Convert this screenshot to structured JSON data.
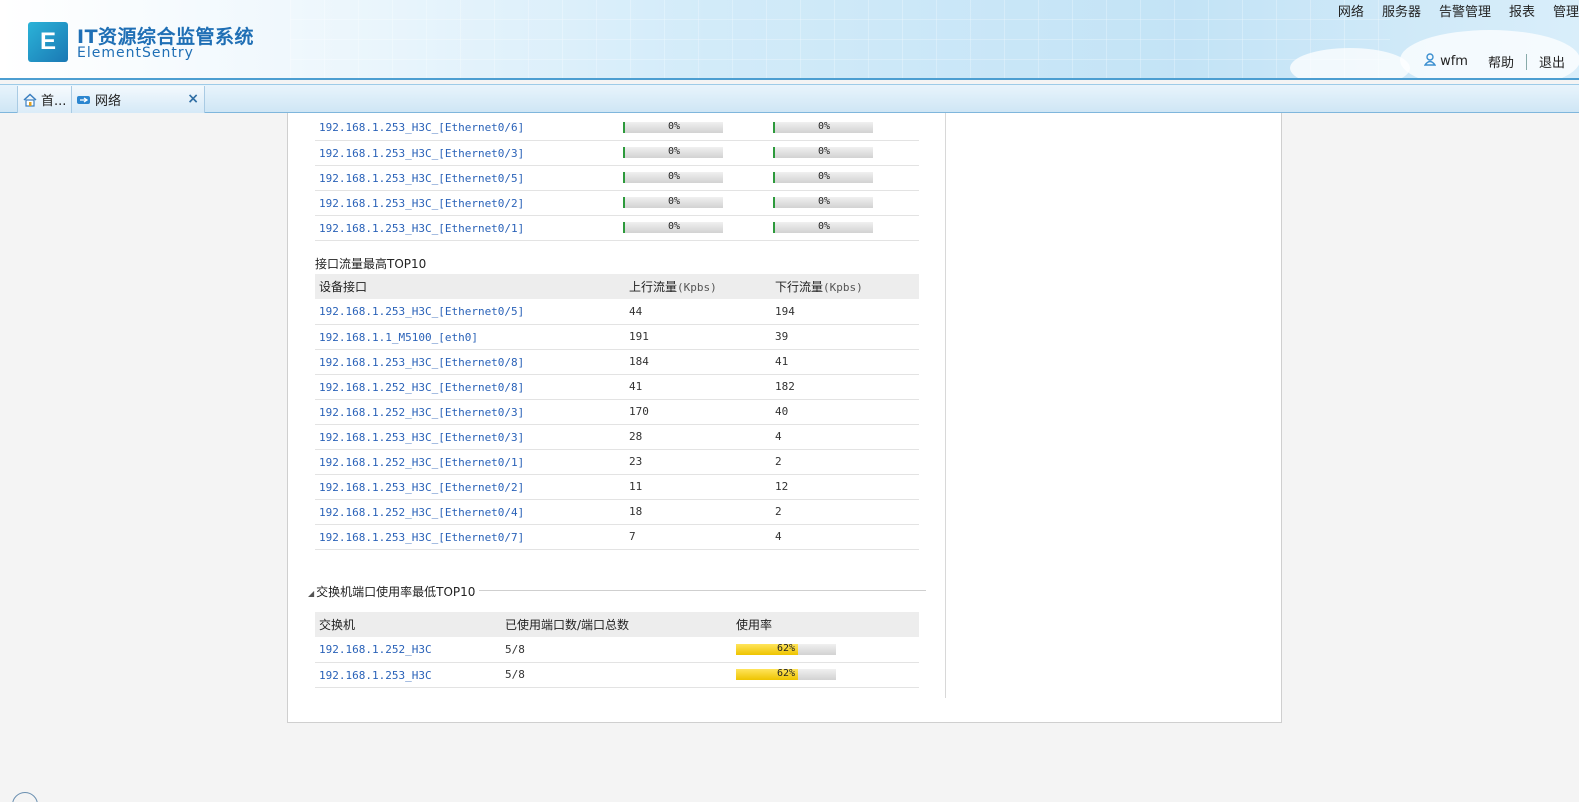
{
  "app": {
    "title": "IT资源综合监管系统",
    "subtitle": "ElementSentry",
    "logo_letter": "E"
  },
  "top_nav": [
    "网络",
    "服务器",
    "告警管理",
    "报表",
    "管理"
  ],
  "user_bar": {
    "username": "wfm",
    "help": "帮助",
    "logout": "退出"
  },
  "tabs": {
    "home": "首...",
    "network": "网络",
    "close": "×"
  },
  "util_table": {
    "rows": [
      {
        "device": "192.168.1.253_H3C_[Ethernet0/6]",
        "in": "0%",
        "out": "0%"
      },
      {
        "device": "192.168.1.253_H3C_[Ethernet0/3]",
        "in": "0%",
        "out": "0%"
      },
      {
        "device": "192.168.1.253_H3C_[Ethernet0/5]",
        "in": "0%",
        "out": "0%"
      },
      {
        "device": "192.168.1.253_H3C_[Ethernet0/2]",
        "in": "0%",
        "out": "0%"
      },
      {
        "device": "192.168.1.253_H3C_[Ethernet0/1]",
        "in": "0%",
        "out": "0%"
      }
    ]
  },
  "traffic_top10": {
    "title": "接口流量最高TOP10",
    "headers": {
      "device": "设备接口",
      "up": "上行流量",
      "up_unit": "(Kpbs)",
      "down": "下行流量",
      "down_unit": "(Kpbs)"
    },
    "rows": [
      {
        "device": "192.168.1.253_H3C_[Ethernet0/5]",
        "up": "44",
        "down": "194"
      },
      {
        "device": "192.168.1.1_M5100_[eth0]",
        "up": "191",
        "down": "39"
      },
      {
        "device": "192.168.1.253_H3C_[Ethernet0/8]",
        "up": "184",
        "down": "41"
      },
      {
        "device": "192.168.1.252_H3C_[Ethernet0/8]",
        "up": "41",
        "down": "182"
      },
      {
        "device": "192.168.1.252_H3C_[Ethernet0/3]",
        "up": "170",
        "down": "40"
      },
      {
        "device": "192.168.1.253_H3C_[Ethernet0/3]",
        "up": "28",
        "down": "4"
      },
      {
        "device": "192.168.1.252_H3C_[Ethernet0/1]",
        "up": "23",
        "down": "2"
      },
      {
        "device": "192.168.1.253_H3C_[Ethernet0/2]",
        "up": "11",
        "down": "12"
      },
      {
        "device": "192.168.1.252_H3C_[Ethernet0/4]",
        "up": "18",
        "down": "2"
      },
      {
        "device": "192.168.1.253_H3C_[Ethernet0/7]",
        "up": "7",
        "down": "4"
      }
    ]
  },
  "switch_port_top10": {
    "title": "交换机端口使用率最低TOP10",
    "headers": {
      "switch": "交换机",
      "ports": "已使用端口数/端口总数",
      "usage": "使用率"
    },
    "rows": [
      {
        "switch": "192.168.1.252_H3C",
        "ports": "5/8",
        "usage": "62%",
        "usage_value": 62
      },
      {
        "switch": "192.168.1.253_H3C",
        "ports": "5/8",
        "usage": "62%",
        "usage_value": 62
      }
    ]
  },
  "colors": {
    "link": "#2a62b8",
    "header_border": "#4c9ed1",
    "bar_green": "#2d9a3c",
    "bar_yellow": "#eec400"
  }
}
